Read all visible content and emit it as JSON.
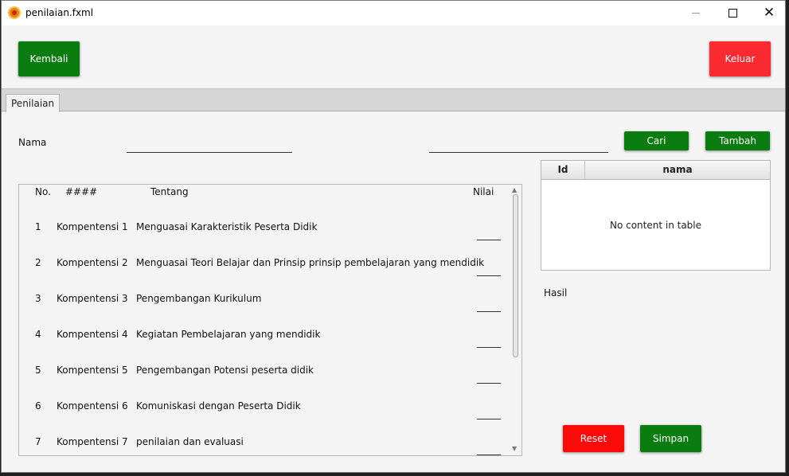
{
  "window": {
    "title": "penilaian.fxml",
    "close_glyph": "✕"
  },
  "toolbar": {
    "back_label": "Kembali",
    "exit_label": "Keluar"
  },
  "tabs": [
    {
      "label": "Penilaian",
      "selected": true
    }
  ],
  "search": {
    "name_label": "Nama",
    "name_value": "",
    "search_value": "",
    "search_label": "Cari",
    "add_label": "Tambah"
  },
  "list": {
    "headers": {
      "no": "No.",
      "code": "####",
      "topic": "Tentang",
      "score": "Nilai"
    },
    "rows": [
      {
        "no": "1",
        "code": "Kompentensi 1",
        "topic": "Menguasai Karakteristik Peserta Didik",
        "score": ""
      },
      {
        "no": "2",
        "code": "Kompentensi 2",
        "topic": "Menguasai Teori Belajar dan Prinsip prinsip pembelajaran yang mendidik",
        "score": ""
      },
      {
        "no": "3",
        "code": "Kompentensi 3",
        "topic": "Pengembangan Kurikulum",
        "score": ""
      },
      {
        "no": "4",
        "code": "Kompentensi 4",
        "topic": "Kegiatan Pembelajaran yang mendidik",
        "score": ""
      },
      {
        "no": "5",
        "code": "Kompentensi 5",
        "topic": "Pengembangan Potensi peserta didik",
        "score": ""
      },
      {
        "no": "6",
        "code": "Kompentensi 6",
        "topic": "Komuniskasi dengan Peserta Didik",
        "score": ""
      },
      {
        "no": "7",
        "code": "Kompentensi 7",
        "topic": "penilaian dan evaluasi",
        "score": ""
      }
    ]
  },
  "table": {
    "columns": [
      "Id",
      "nama"
    ],
    "empty_text": "No content in table"
  },
  "result": {
    "label": "Hasil"
  },
  "actions": {
    "reset_label": "Reset",
    "save_label": "Simpan"
  },
  "colors": {
    "green": "#0b7d10",
    "red": "#fb2a31",
    "accent_red": "#fb0a0a"
  }
}
